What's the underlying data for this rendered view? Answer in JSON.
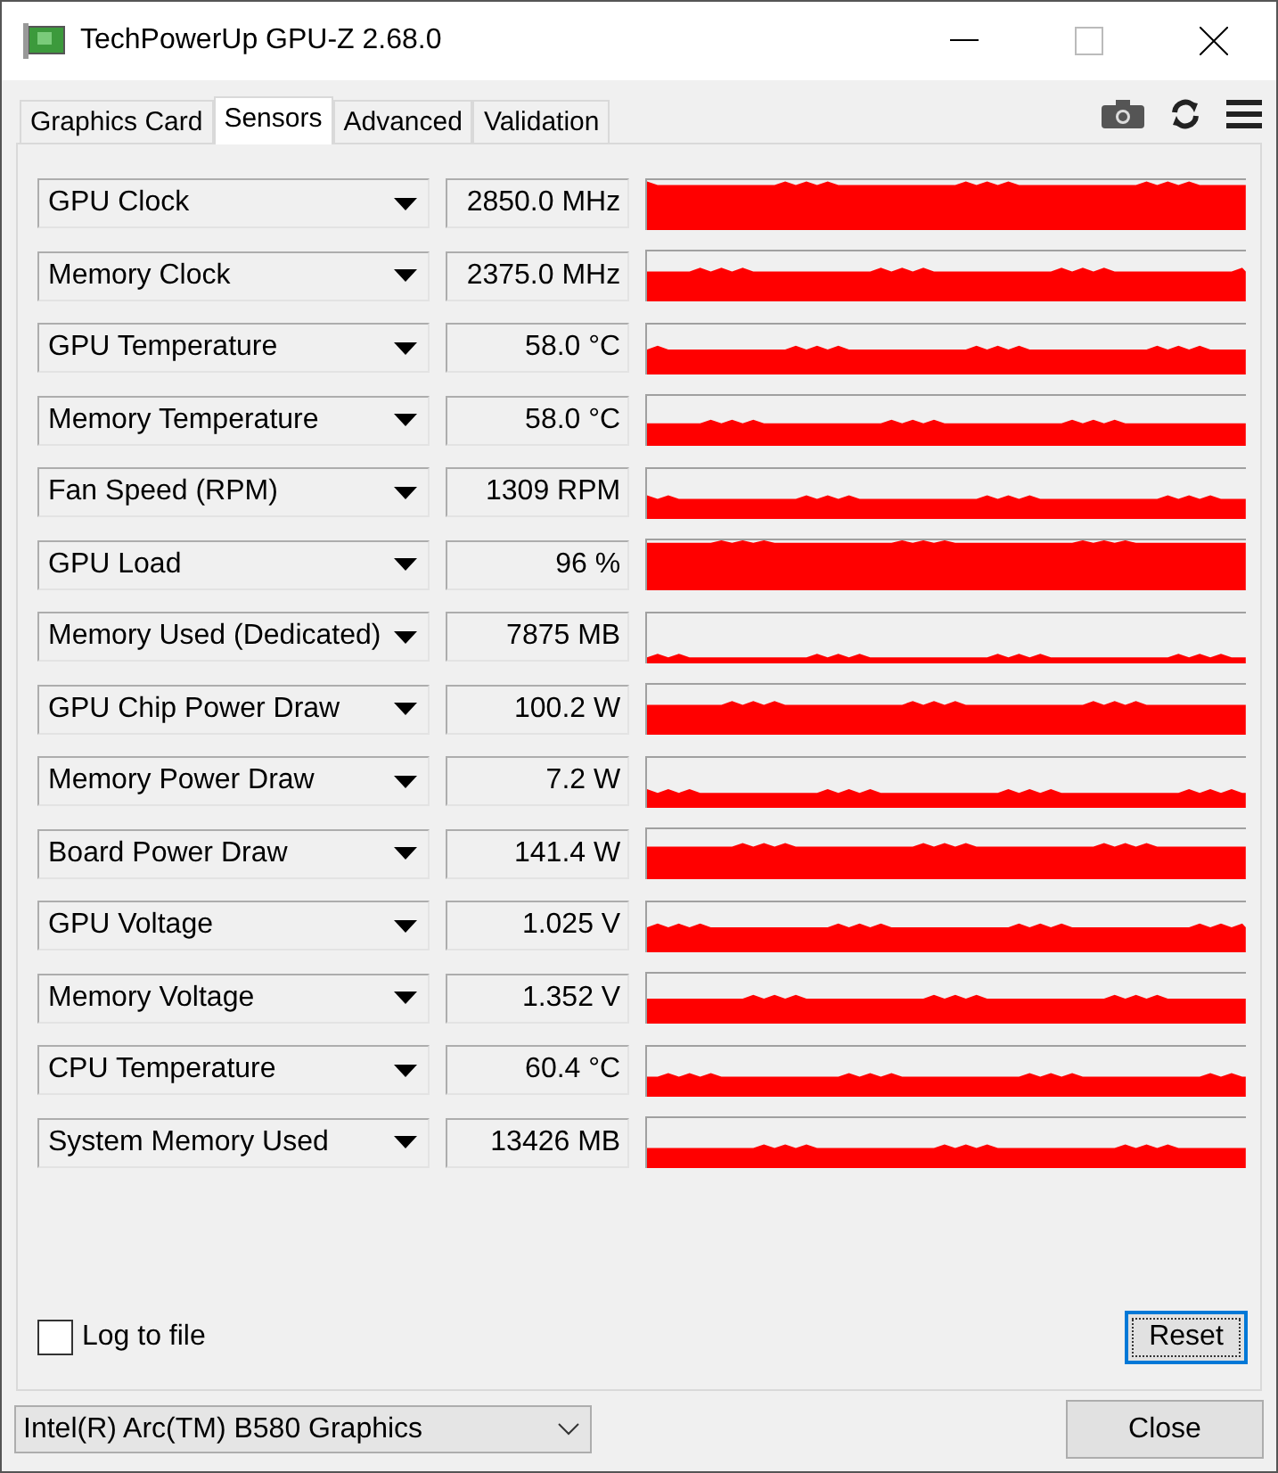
{
  "window": {
    "title": "TechPowerUp GPU-Z 2.68.0"
  },
  "tabs": [
    {
      "label": "Graphics Card",
      "selected": false
    },
    {
      "label": "Sensors",
      "selected": true
    },
    {
      "label": "Advanced",
      "selected": false
    },
    {
      "label": "Validation",
      "selected": false
    }
  ],
  "sensors": [
    {
      "name": "GPU Clock",
      "value": "2850.0 MHz"
    },
    {
      "name": "Memory Clock",
      "value": "2375.0 MHz"
    },
    {
      "name": "GPU Temperature",
      "value": "58.0 °C"
    },
    {
      "name": "Memory Temperature",
      "value": "58.0 °C"
    },
    {
      "name": "Fan Speed (RPM)",
      "value": "1309 RPM"
    },
    {
      "name": "GPU Load",
      "value": "96 %"
    },
    {
      "name": "Memory Used (Dedicated)",
      "value": "7875 MB"
    },
    {
      "name": "GPU Chip Power Draw",
      "value": "100.2 W"
    },
    {
      "name": "Memory Power Draw",
      "value": "7.2 W"
    },
    {
      "name": "Board Power Draw",
      "value": "141.4 W"
    },
    {
      "name": "GPU Voltage",
      "value": "1.025 V"
    },
    {
      "name": "Memory Voltage",
      "value": "1.352 V"
    },
    {
      "name": "CPU Temperature",
      "value": "60.4 °C"
    },
    {
      "name": "System Memory Used",
      "value": "13426 MB"
    }
  ],
  "log_to_file": {
    "label": "Log to file",
    "checked": false
  },
  "reset_button": "Reset",
  "device_select": "Intel(R) Arc(TM) B580 Graphics",
  "close_button": "Close"
}
